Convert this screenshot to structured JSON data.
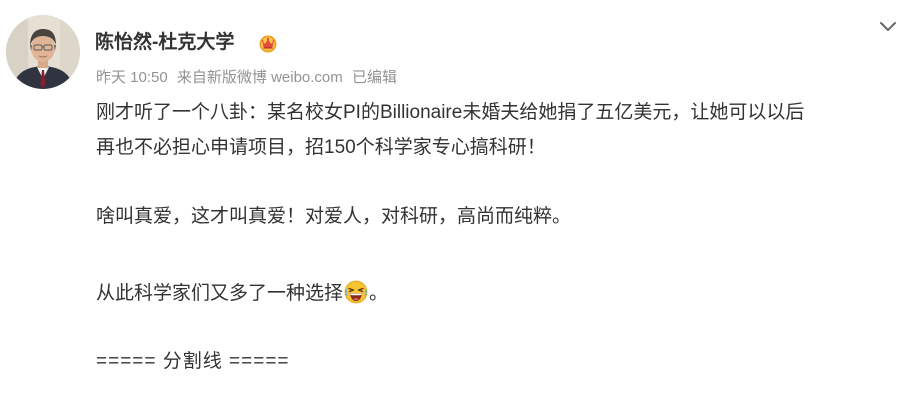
{
  "post": {
    "author": {
      "name": "陈怡然-杜克大学",
      "avatar_icon": "user-avatar",
      "badge_icon": "vip-crown-icon"
    },
    "meta": {
      "time": "昨天 10:50",
      "source_prefix": "来自",
      "source": "新版微博 weibo.com",
      "edited": "已编辑"
    },
    "content": {
      "line1": "刚才听了一个八卦：某名校女PI的Billionaire未婚夫给她捐了五亿美元，让她可以以后",
      "line2": "再也不必担心申请项目，招150个科学家专心搞科研！",
      "line3": "啥叫真爱，这才叫真爱！对爱人，对科研，高尚而纯粹。",
      "line4_before": "从此科学家们又多了一种选择",
      "line4_emoji": "laughing-emoji",
      "line4_after": "。",
      "line5": "===== 分割线 ====="
    },
    "more_icon": "chevron-down-icon"
  }
}
